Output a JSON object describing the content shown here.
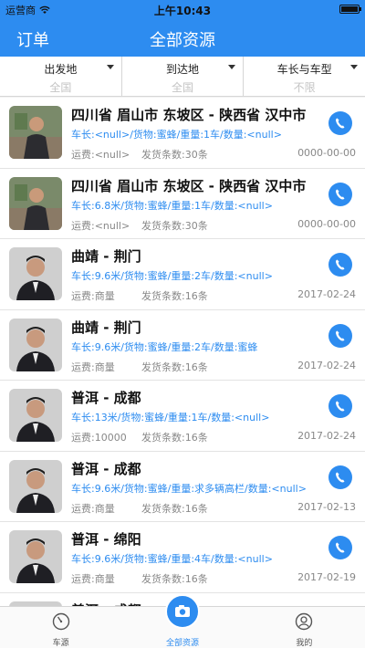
{
  "status": {
    "carrier": "运营商",
    "time": "上午10:43"
  },
  "nav": {
    "left": "订单",
    "title": "全部资源"
  },
  "filters": [
    {
      "label": "出发地",
      "value": "全国"
    },
    {
      "label": "到达地",
      "value": "全国"
    },
    {
      "label": "车长与车型",
      "value": "不限"
    }
  ],
  "colors": {
    "accent": "#2d8cf0"
  },
  "rows": [
    {
      "route": "四川省 眉山市 东坡区 - 陕西省 汉中市",
      "detail": "车长:<null>/货物:蜜蜂/重量:1车/数量:<null>",
      "freight": "运费:<null>",
      "count": "发货条数:30条",
      "date": "0000-00-00"
    },
    {
      "route": "四川省 眉山市 东坡区 - 陕西省 汉中市",
      "detail": "车长:6.8米/货物:蜜蜂/重量:1车/数量:<null>",
      "freight": "运费:<null>",
      "count": "发货条数:30条",
      "date": "0000-00-00"
    },
    {
      "route": "曲靖 - 荆门",
      "detail": "车长:9.6米/货物:蜜蜂/重量:2车/数量:<null>",
      "freight": "运费:商量",
      "count": "发货条数:16条",
      "date": "2017-02-24"
    },
    {
      "route": "曲靖 - 荆门",
      "detail": "车长:9.6米/货物:蜜蜂/重量:2车/数量:蜜蜂",
      "freight": "运费:商量",
      "count": "发货条数:16条",
      "date": "2017-02-24"
    },
    {
      "route": "普洱 - 成都",
      "detail": "车长:13米/货物:蜜蜂/重量:1车/数量:<null>",
      "freight": "运费:10000",
      "count": "发货条数:16条",
      "date": "2017-02-24"
    },
    {
      "route": "普洱 - 成都",
      "detail": "车长:9.6米/货物:蜜蜂/重量:求多辆高栏/数量:<null>",
      "freight": "运费:商量",
      "count": "发货条数:16条",
      "date": "2017-02-13"
    },
    {
      "route": "普洱 - 绵阳",
      "detail": "车长:9.6米/货物:蜜蜂/重量:4车/数量:<null>",
      "freight": "运费:商量",
      "count": "发货条数:16条",
      "date": "2017-02-19"
    },
    {
      "route": "普洱 - 成都",
      "detail": "",
      "freight": "",
      "count": "",
      "date": ""
    }
  ],
  "tabs": [
    {
      "label": "车源",
      "icon": "gauge-icon"
    },
    {
      "label": "全部资源",
      "icon": "camera-icon"
    },
    {
      "label": "我的",
      "icon": "user-icon"
    }
  ]
}
